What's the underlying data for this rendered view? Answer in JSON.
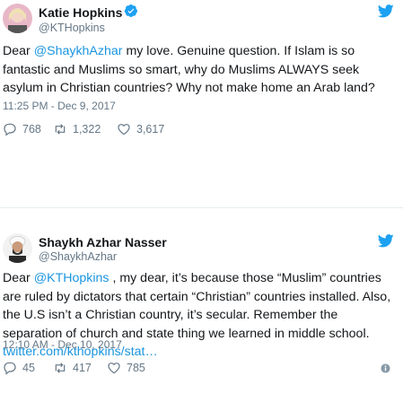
{
  "tweets": [
    {
      "name": "Katie Hopkins",
      "handle": "@KTHopkins",
      "text_prefix": "Dear ",
      "mention": "@ShaykhAzhar",
      "text_body": " my love. Genuine question. If Islam is so fantastic and Muslims so smart, why do Muslims ALWAYS seek asylum in Christian countries? Why not make home an Arab land?",
      "timestamp": "11:25 PM - Dec 9, 2017",
      "replies": "768",
      "retweets": "1,322",
      "likes": "3,617"
    },
    {
      "name": "Shaykh Azhar Nasser",
      "handle": "@ShaykhAzhar",
      "text_prefix": "Dear ",
      "mention": "@KTHopkins",
      "text_body": " , my dear, it’s because those “Muslim” countries are ruled by dictators that certain “Christian” countries installed. Also, the U.S isn’t a Christian country, it’s secular. Remember the separation of church and state thing we learned in middle school. ",
      "link": "twitter.com/kthopkins/stat…",
      "timestamp": "12:10 AM - Dec 10, 2017",
      "replies": "45",
      "retweets": "417",
      "likes": "785"
    }
  ],
  "colors": {
    "accent": "#1da1f2",
    "link": "#1b95e0",
    "muted": "#657786"
  },
  "icons": [
    "verified-icon",
    "twitter-bird-icon",
    "reply-icon",
    "retweet-icon",
    "like-icon",
    "info-icon"
  ]
}
